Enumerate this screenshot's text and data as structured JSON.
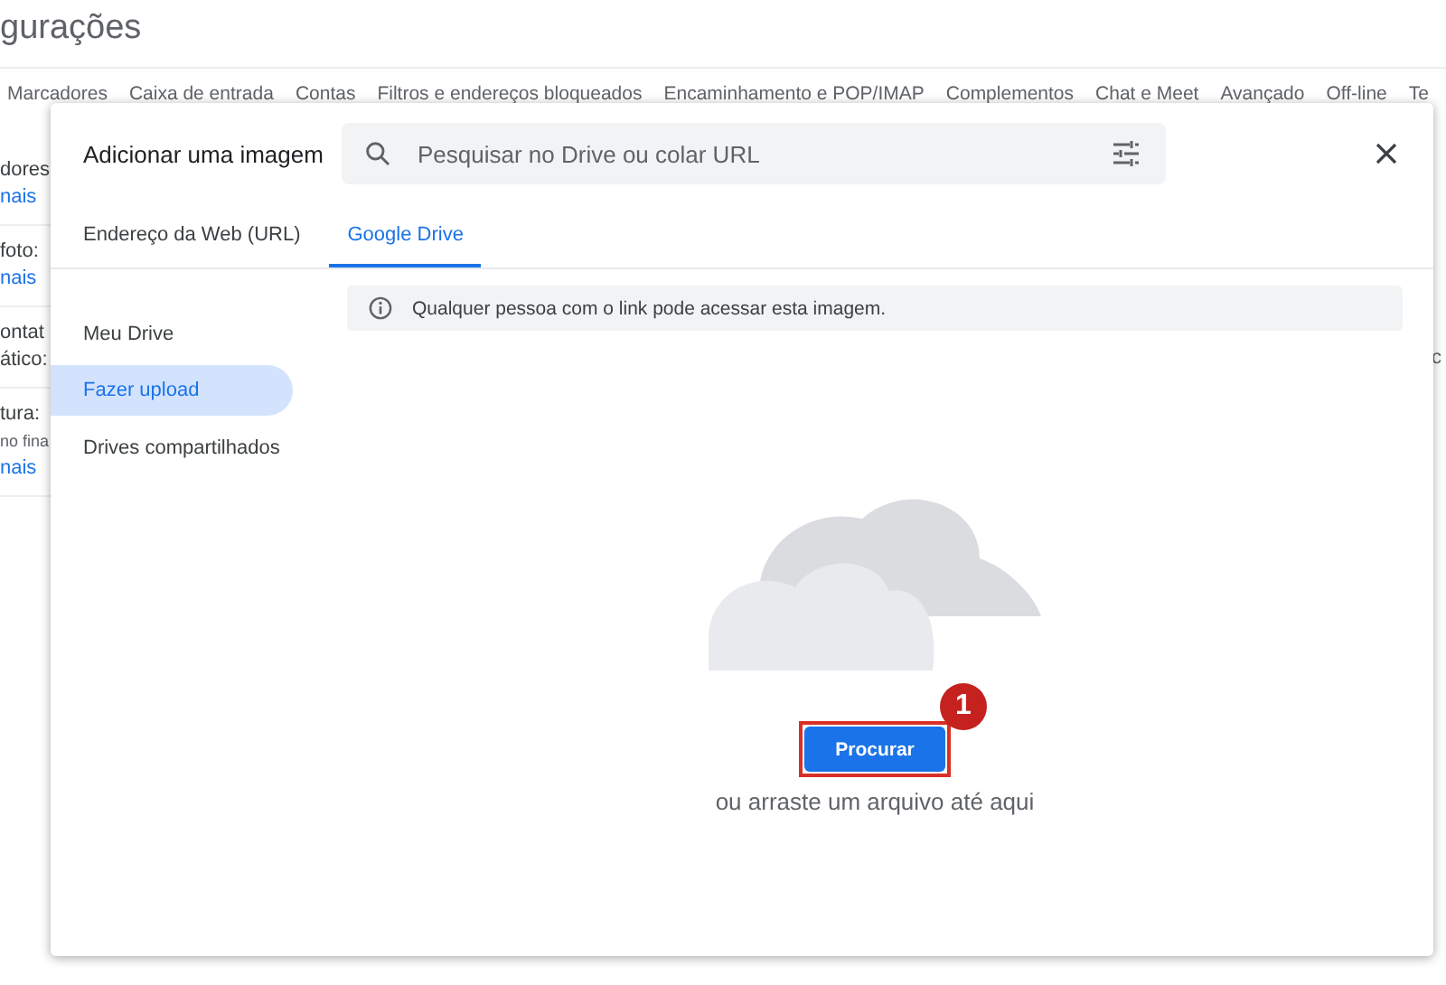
{
  "page": {
    "title": "gurações",
    "tabs": [
      "Marcadores",
      "Caixa de entrada",
      "Contas",
      "Filtros e endereços bloqueados",
      "Encaminhamento e POP/IMAP",
      "Complementos",
      "Chat e Meet",
      "Avançado",
      "Off-line",
      "Te"
    ],
    "groups": [
      [
        {
          "text": "dores",
          "kind": "label"
        },
        {
          "text": "nais",
          "kind": "link"
        }
      ],
      [
        {
          "text": "foto:",
          "kind": "label"
        },
        {
          "text": "nais",
          "kind": "link"
        }
      ],
      [
        {
          "text": "ontat",
          "kind": "label"
        },
        {
          "text": "ático:",
          "kind": "label"
        }
      ],
      [
        {
          "text": "tura:",
          "kind": "label"
        },
        {
          "text": "no fina",
          "kind": "note"
        },
        {
          "text": "nais",
          "kind": "link"
        }
      ]
    ],
    "right_snippet": "c"
  },
  "dialog": {
    "title": "Adicionar uma imagem",
    "search": {
      "placeholder": "Pesquisar no Drive ou colar URL"
    },
    "tabs": [
      {
        "label": "Endereço da Web (URL)",
        "selected": false
      },
      {
        "label": "Google Drive",
        "selected": true
      }
    ],
    "sidebar": [
      {
        "label": "Meu Drive",
        "selected": false
      },
      {
        "label": "Fazer upload",
        "selected": true
      },
      {
        "label": "Drives compartilhados",
        "selected": false
      }
    ],
    "notice": "Qualquer pessoa com o link pode acessar esta imagem.",
    "upload": {
      "button": "Procurar",
      "hint": "ou arraste um arquivo até aqui"
    }
  },
  "annotation": {
    "number": "1"
  }
}
